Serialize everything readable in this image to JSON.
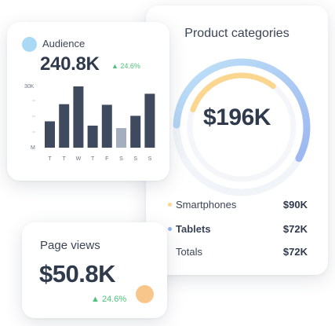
{
  "colors": {
    "audience_dot": "#a9d9f5",
    "bar_dark": "#3f4a5e",
    "bar_light": "#a4aebd",
    "positive": "#4cc17a",
    "smartphones": "#fbd68e",
    "tablets": "#8fb4f0",
    "pageviews_dot": "#f8c68a"
  },
  "audience": {
    "label": "Audience",
    "value": "240.8K",
    "change": "▲ 24.6%",
    "y_labels": [
      "30K",
      "M"
    ],
    "chart_data": {
      "type": "bar",
      "categories": [
        "T",
        "T",
        "W",
        "T",
        "F",
        "S",
        "S",
        "S"
      ],
      "values": [
        0.43,
        0.71,
        1.0,
        0.36,
        0.7,
        0.32,
        0.52,
        0.88
      ],
      "highlight_index": 5,
      "ylim": [
        0,
        1
      ]
    }
  },
  "products": {
    "title": "Product categories",
    "total": "$196K",
    "segments": [
      {
        "name": "Smartphones",
        "fraction": 0.46,
        "color_key": "smartphones"
      },
      {
        "name": "Tablets",
        "fraction": 0.37,
        "color_key": "tablets"
      }
    ],
    "legend": [
      {
        "label": "Smartphones",
        "value": "$90K",
        "dot": "smartphones"
      },
      {
        "label": "Tablets",
        "value": "$72K",
        "dot": "tablets"
      },
      {
        "label": "Totals",
        "value": "$72K",
        "dot": ""
      }
    ]
  },
  "pageviews": {
    "label": "Page views",
    "value": "$50.8K",
    "change": "▲ 24.6%"
  }
}
